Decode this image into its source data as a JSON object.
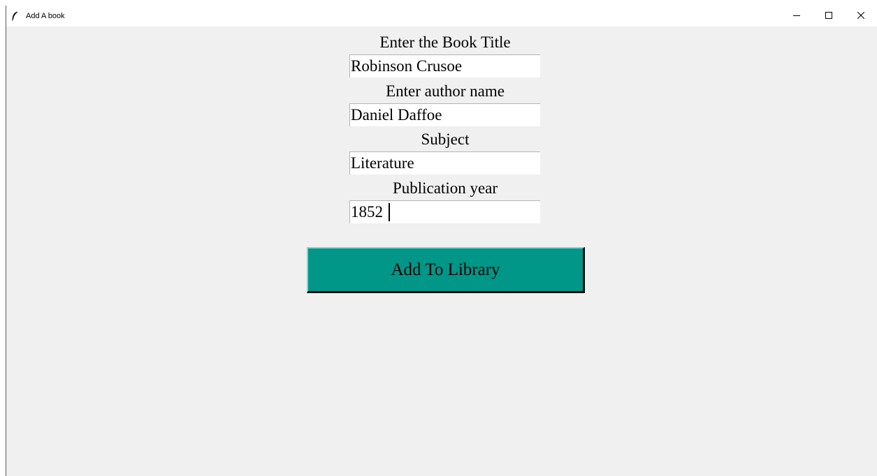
{
  "window": {
    "title": "Add A book",
    "controls": {
      "minimize": "–",
      "maximize": "☐",
      "close": "✕"
    }
  },
  "form": {
    "title_label": "Enter the Book Title",
    "title_value": "Robinson Crusoe",
    "author_label": "Enter author name",
    "author_value": "Daniel Daffoe",
    "subject_label": "Subject",
    "subject_value": "Literature",
    "year_label": "Publication year",
    "year_value": "1852",
    "submit_label": "Add To Library"
  },
  "colors": {
    "window_bg": "#f0f0f0",
    "button_bg": "#009688",
    "input_bg": "#ffffff"
  },
  "icons": {
    "app": "feather-icon",
    "minimize": "minimize-icon",
    "maximize": "maximize-icon",
    "close": "close-icon"
  }
}
